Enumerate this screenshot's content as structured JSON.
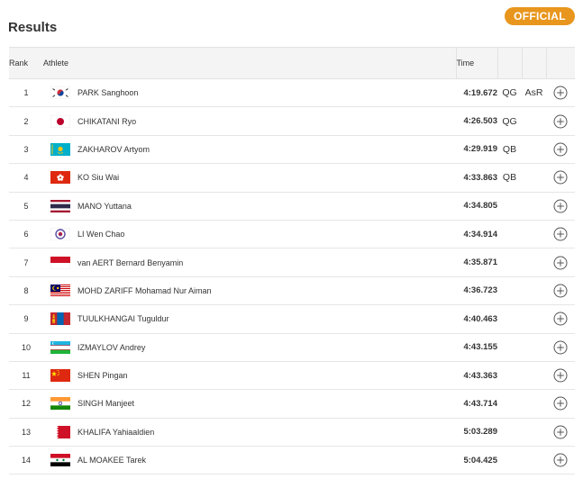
{
  "page": {
    "title": "Results",
    "status_badge": "OFFICIAL"
  },
  "table": {
    "headers": {
      "rank": "Rank",
      "athlete": "Athlete",
      "time": "Time"
    },
    "rows": [
      {
        "rank": "1",
        "flag": "korea-flag-icon",
        "athlete": "PARK Sanghoon",
        "time": "4:19.672",
        "qual": "QG",
        "record": "AsR"
      },
      {
        "rank": "2",
        "flag": "japan-flag-icon",
        "athlete": "CHIKATANI Ryo",
        "time": "4:26.503",
        "qual": "QG",
        "record": ""
      },
      {
        "rank": "3",
        "flag": "kazakhstan-flag-icon",
        "athlete": "ZAKHAROV Artyom",
        "time": "4:29.919",
        "qual": "QB",
        "record": ""
      },
      {
        "rank": "4",
        "flag": "hong-kong-flag-icon",
        "athlete": "KO Siu Wai",
        "time": "4:33.863",
        "qual": "QB",
        "record": ""
      },
      {
        "rank": "5",
        "flag": "thailand-flag-icon",
        "athlete": "MANO Yuttana",
        "time": "4:34.805",
        "qual": "",
        "record": ""
      },
      {
        "rank": "6",
        "flag": "chinese-taipei-flag-icon",
        "athlete": "LI Wen Chao",
        "time": "4:34.914",
        "qual": "",
        "record": ""
      },
      {
        "rank": "7",
        "flag": "indonesia-flag-icon",
        "athlete": "van AERT Bernard Benyamin",
        "time": "4:35.871",
        "qual": "",
        "record": ""
      },
      {
        "rank": "8",
        "flag": "malaysia-flag-icon",
        "athlete": "MOHD ZARIFF Mohamad Nur Aiman",
        "time": "4:36.723",
        "qual": "",
        "record": ""
      },
      {
        "rank": "9",
        "flag": "mongolia-flag-icon",
        "athlete": "TUULKHANGAI Tuguldur",
        "time": "4:40.463",
        "qual": "",
        "record": ""
      },
      {
        "rank": "10",
        "flag": "uzbekistan-flag-icon",
        "athlete": "IZMAYLOV Andrey",
        "time": "4:43.155",
        "qual": "",
        "record": ""
      },
      {
        "rank": "11",
        "flag": "china-flag-icon",
        "athlete": "SHEN Pingan",
        "time": "4:43.363",
        "qual": "",
        "record": ""
      },
      {
        "rank": "12",
        "flag": "india-flag-icon",
        "athlete": "SINGH Manjeet",
        "time": "4:43.714",
        "qual": "",
        "record": ""
      },
      {
        "rank": "13",
        "flag": "bahrain-flag-icon",
        "athlete": "KHALIFA Yahiaaldien",
        "time": "5:03.289",
        "qual": "",
        "record": ""
      },
      {
        "rank": "14",
        "flag": "syria-flag-icon",
        "athlete": "AL MOAKEE Tarek",
        "time": "5:04.425",
        "qual": "",
        "record": ""
      }
    ]
  },
  "colors": {
    "badge": "#e8961e",
    "header_bg": "#f4f4f4",
    "row_border": "#e6e6e6"
  },
  "icons": {
    "expand": "plus-circle-icon"
  }
}
